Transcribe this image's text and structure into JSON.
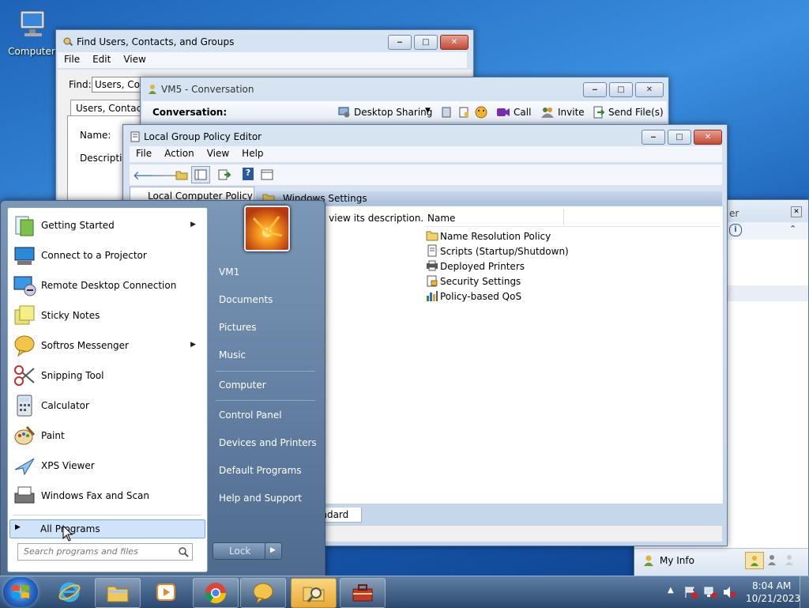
{
  "desktop": {
    "computer_icon_label": "Computer"
  },
  "find_window": {
    "title": "Find Users, Contacts, and Groups",
    "menu": [
      "File",
      "Edit",
      "View"
    ],
    "find_label": "Find:",
    "find_value": "Users, Conta",
    "tab_label": "Users, Contacts,",
    "name_label": "Name:",
    "description_label": "Description"
  },
  "conversation_window": {
    "title": "VM5 - Conversation",
    "conversation_label": "Conversation:",
    "desktop_sharing": "Desktop Sharing",
    "call": "Call",
    "invite": "Invite",
    "send_files": "Send File(s)"
  },
  "gpo_window": {
    "title": "Local Group Policy Editor",
    "menu": [
      "File",
      "Action",
      "View",
      "Help"
    ],
    "tree_root": "Local Computer Policy",
    "header_folder": "Windows Settings",
    "description_hint": "o view its description.",
    "column_name": "Name",
    "items": [
      {
        "icon": "folder-icon",
        "label": "Name Resolution Policy"
      },
      {
        "icon": "script-icon",
        "label": "Scripts (Startup/Shutdown)"
      },
      {
        "icon": "printer-icon",
        "label": "Deployed Printers"
      },
      {
        "icon": "security-icon",
        "label": "Security Settings"
      },
      {
        "icon": "chart-icon",
        "label": "Policy-based QoS"
      }
    ],
    "tab_standard": "andard"
  },
  "messenger_panel": {
    "title_fragment": "er",
    "my_info": "My Info"
  },
  "start_menu": {
    "programs": [
      {
        "label": "Getting Started",
        "icon": "getting-started-icon",
        "submenu": true
      },
      {
        "label": "Connect to a Projector",
        "icon": "projector-icon",
        "submenu": false
      },
      {
        "label": "Remote Desktop Connection",
        "icon": "remote-desktop-icon",
        "submenu": false
      },
      {
        "label": "Sticky Notes",
        "icon": "sticky-notes-icon",
        "submenu": false
      },
      {
        "label": "Softros Messenger",
        "icon": "messenger-icon",
        "submenu": true
      },
      {
        "label": "Snipping Tool",
        "icon": "scissors-icon",
        "submenu": false
      },
      {
        "label": "Calculator",
        "icon": "calculator-icon",
        "submenu": false
      },
      {
        "label": "Paint",
        "icon": "paint-icon",
        "submenu": false
      },
      {
        "label": "XPS Viewer",
        "icon": "xps-icon",
        "submenu": false
      },
      {
        "label": "Windows Fax and Scan",
        "icon": "fax-icon",
        "submenu": false
      }
    ],
    "all_programs": "All Programs",
    "search_placeholder": "Search programs and files",
    "right_items": [
      "VM1",
      "Documents",
      "Pictures",
      "Music",
      "Computer",
      "Control Panel",
      "Devices and Printers",
      "Default Programs",
      "Help and Support"
    ],
    "lock_label": "Lock"
  },
  "taskbar": {
    "apps": [
      "internet-explorer-icon",
      "explorer-icon",
      "media-player-icon",
      "chrome-icon",
      "messenger-icon",
      "search-folder-icon",
      "toolbox-icon"
    ],
    "time": "8:04 AM",
    "date": "10/21/2023"
  },
  "colors": {
    "desktop": "#1e63b8",
    "taskbar": "#2c4a70",
    "close_button": "#c24a35",
    "selected": "#cfe3fb"
  }
}
